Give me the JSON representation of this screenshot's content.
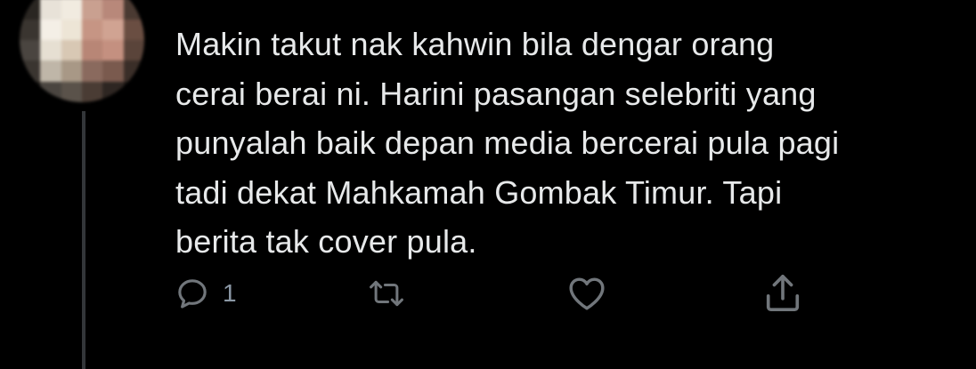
{
  "tweet": {
    "text_lines": [
      "Makin takut nak kahwin bila dengar orang",
      "cerai berai ni. Harini pasangan selebriti yang",
      "punyalah baik depan media bercerai pula pagi",
      "tadi dekat Mahkamah Gombak Timur. Tapi",
      "berita tak cover pula."
    ],
    "reply_count": "1"
  },
  "icons": {
    "reply": "reply-icon",
    "retweet": "retweet-icon",
    "like": "heart-icon",
    "share": "share-icon"
  },
  "colors": {
    "background": "#000000",
    "text": "#e7e9ea",
    "icon": "#71767b"
  }
}
